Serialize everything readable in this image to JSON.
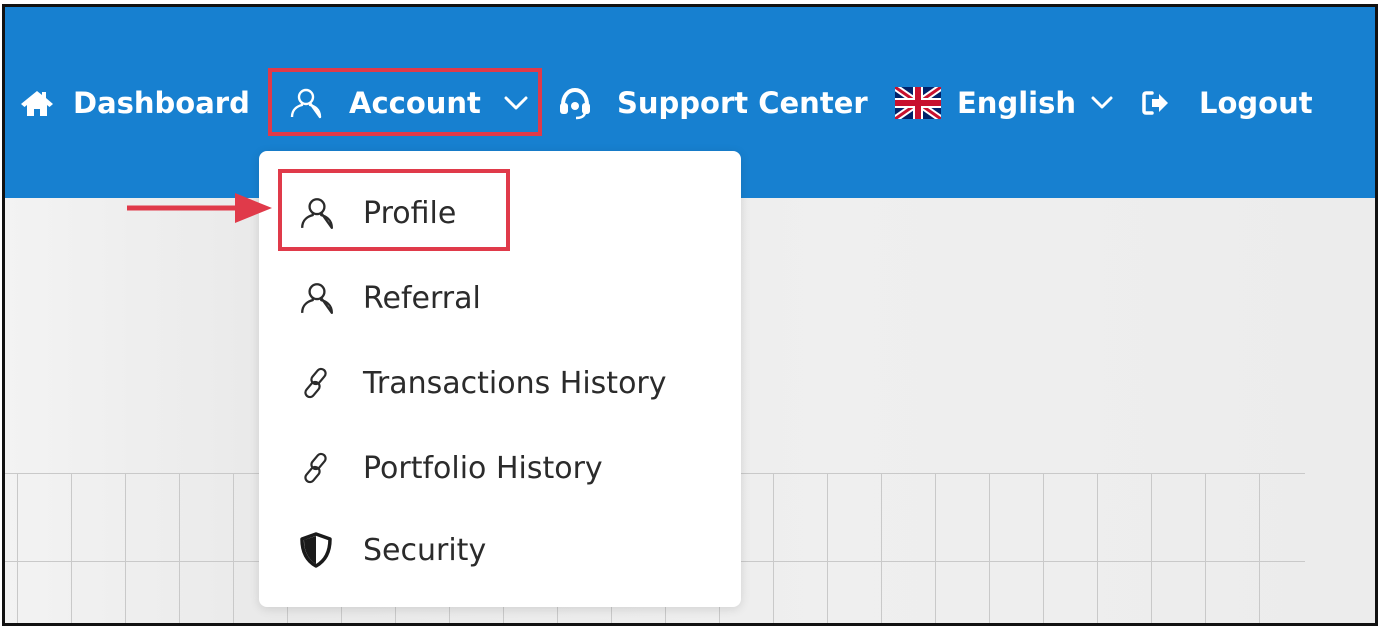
{
  "nav": {
    "dashboard": {
      "label": "Dashboard",
      "icon": "home-icon"
    },
    "account": {
      "label": "Account",
      "icon": "user-icon",
      "chevron": "chevron-down-icon"
    },
    "support": {
      "label": "Support Center",
      "icon": "headset-icon"
    },
    "language": {
      "label": "English",
      "icon": "uk-flag-icon",
      "chevron": "chevron-down-icon"
    },
    "logout": {
      "label": "Logout",
      "icon": "sign-out-icon"
    }
  },
  "account_menu": {
    "items": [
      {
        "label": "Profile",
        "icon": "user-icon"
      },
      {
        "label": "Referral",
        "icon": "user-icon"
      },
      {
        "label": "Transactions History",
        "icon": "link-icon"
      },
      {
        "label": "Portfolio History",
        "icon": "link-icon"
      },
      {
        "label": "Security",
        "icon": "shield-icon"
      }
    ]
  },
  "colors": {
    "topbar": "#1780d0",
    "highlight": "#e03a4a",
    "menu_text": "#2b2b2b",
    "page_bg": "#eeeeee"
  }
}
